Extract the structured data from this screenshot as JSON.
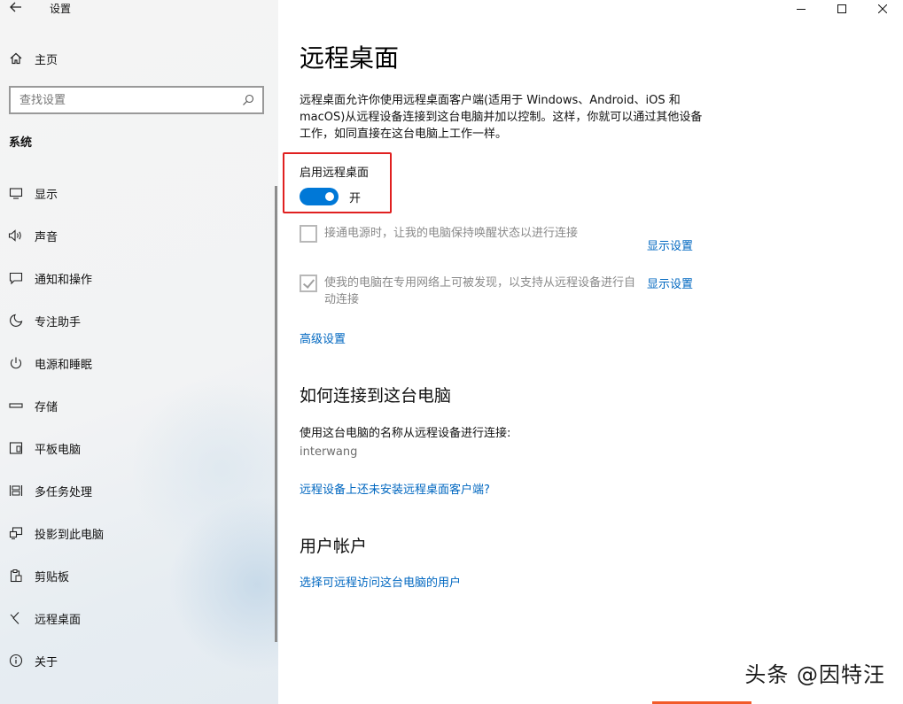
{
  "window": {
    "title": "设置"
  },
  "sidebar": {
    "home_label": "主页",
    "search_placeholder": "查找设置",
    "section": "系统",
    "items": [
      {
        "label": "显示",
        "icon": "monitor-icon"
      },
      {
        "label": "声音",
        "icon": "speaker-icon"
      },
      {
        "label": "通知和操作",
        "icon": "notification-icon"
      },
      {
        "label": "专注助手",
        "icon": "moon-icon"
      },
      {
        "label": "电源和睡眠",
        "icon": "power-icon"
      },
      {
        "label": "存储",
        "icon": "storage-icon"
      },
      {
        "label": "平板电脑",
        "icon": "tablet-icon"
      },
      {
        "label": "多任务处理",
        "icon": "multitask-icon"
      },
      {
        "label": "投影到此电脑",
        "icon": "project-icon"
      },
      {
        "label": "剪贴板",
        "icon": "clipboard-icon"
      },
      {
        "label": "远程桌面",
        "icon": "remote-desktop-icon",
        "selected": true
      },
      {
        "label": "关于",
        "icon": "info-icon"
      }
    ]
  },
  "main": {
    "title": "远程桌面",
    "description": "远程桌面允许你使用远程桌面客户端(适用于 Windows、Android、iOS 和 macOS)从远程设备连接到这台电脑并加以控制。这样，你就可以通过其他设备工作，如同直接在这台电脑上工作一样。",
    "enable_label": "启用远程桌面",
    "toggle_state": "开",
    "toggle_on": true,
    "options": [
      {
        "text": "接通电源时，让我的电脑保持唤醒状态以进行连接",
        "checked": false,
        "link": "显示设置"
      },
      {
        "text": "使我的电脑在专用网络上可被发现，以支持从远程设备进行自动连接",
        "checked": true,
        "link": "显示设置"
      }
    ],
    "advanced_link": "高级设置",
    "how_to_heading": "如何连接到这台电脑",
    "how_to_text": "使用这台电脑的名称从远程设备进行连接:",
    "pc_name": "interwang",
    "no_client_link": "远程设备上还未安装远程桌面客户端?",
    "accounts_heading": "用户帐户",
    "accounts_link": "选择可远程访问这台电脑的用户"
  },
  "watermark": "头条 @因特汪",
  "colors": {
    "accent": "#0078d7",
    "link": "#0067c0",
    "highlight": "#e02020"
  }
}
